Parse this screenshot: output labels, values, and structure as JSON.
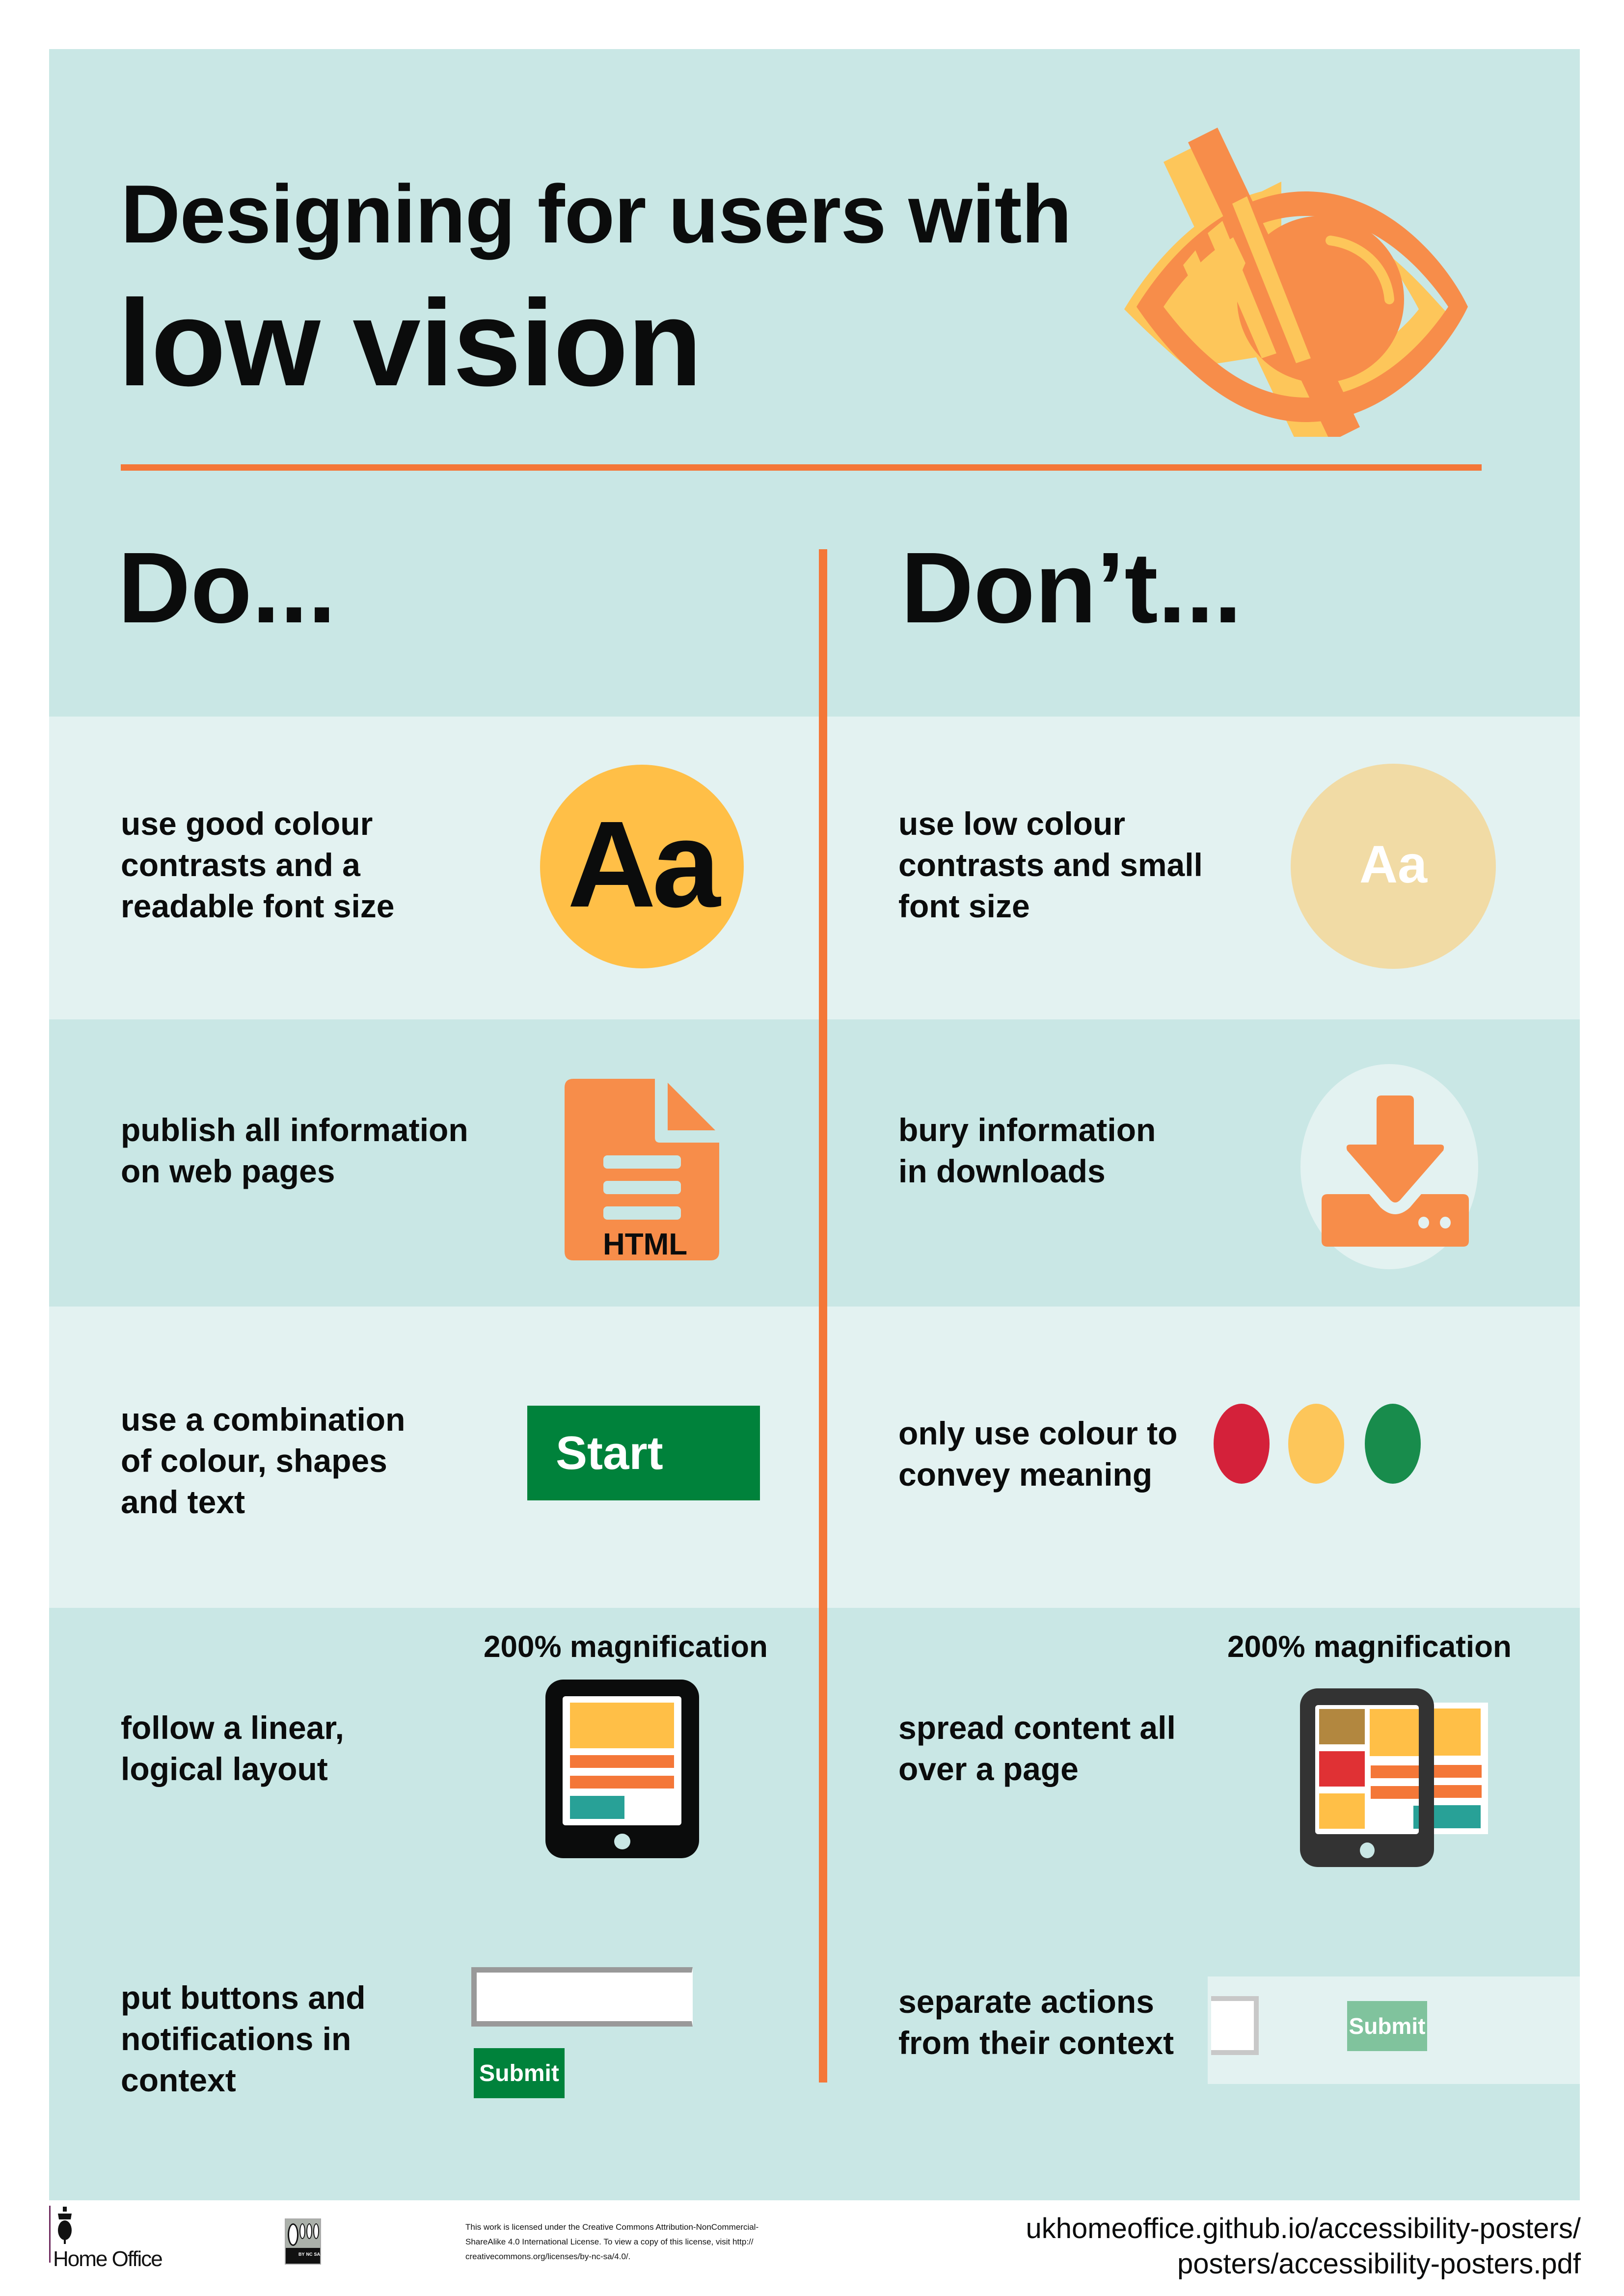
{
  "title": {
    "line1": "Designing for users with",
    "line2": "low vision"
  },
  "columns": {
    "do_heading": "Do...",
    "dont_heading": "Don’t..."
  },
  "do_items": [
    {
      "text": "use good colour\ncontrasts and a\nreadable font size",
      "icon": "high-contrast-text-icon",
      "icon_label": "Aa"
    },
    {
      "text": "publish all information\non web pages",
      "icon": "html-document-icon",
      "icon_label": "HTML"
    },
    {
      "text": "use a combination\nof colour, shapes\nand text",
      "icon": "start-button-example",
      "button_label": "Start"
    },
    {
      "text": "follow a linear,\nlogical layout",
      "icon": "tablet-linear-layout-icon",
      "caption": "200% magnification"
    },
    {
      "text": "put buttons and\nnotifications in\ncontext",
      "icon": "form-in-context-example",
      "button_label": "Submit",
      "input_value": ""
    }
  ],
  "dont_items": [
    {
      "text": "use low colour\ncontrasts and small\nfont size",
      "icon": "low-contrast-text-icon",
      "icon_label": "Aa"
    },
    {
      "text": "bury information\nin downloads",
      "icon": "download-icon"
    },
    {
      "text": "only use colour to\nconvey meaning",
      "icon": "colour-dots-icon"
    },
    {
      "text": "spread content all\nover a page",
      "icon": "tablet-spread-layout-icon",
      "caption": "200% magnification"
    },
    {
      "text": "separate actions\nfrom their context",
      "icon": "form-separated-example",
      "button_label": "Submit",
      "input_value": ""
    }
  ],
  "footer": {
    "org": "Home Office",
    "cc_badge": [
      "BY",
      "NC",
      "SA"
    ],
    "license_text": "This work is licensed under the Creative Commons Attribution-NonCommercial-\nShareAlike 4.0 International License. To view a copy of this license, visit http://\ncreativecommons.org/licenses/by-nc-sa/4.0/.",
    "url": "ukhomeoffice.github.io/accessibility-posters/\nposters/accessibility-posters.pdf"
  },
  "colors": {
    "background": "#c9e7e5",
    "band_light": "#e3f2f1",
    "accent_orange": "#f47738",
    "icon_orange": "#f78d4a",
    "yellow": "#ffbf47",
    "pale_yellow": "#f1dba5",
    "green": "#00823b",
    "pale_green": "#80c39d",
    "red": "#d4213a",
    "dot_yellow": "#fdc65a",
    "dot_green": "#188c4c",
    "brown": "#b2873f",
    "teal": "#28a197"
  }
}
